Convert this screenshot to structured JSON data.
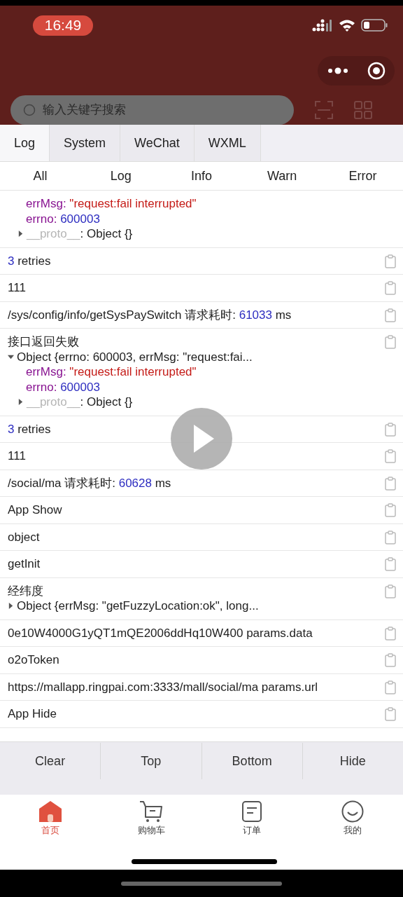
{
  "status_bar": {
    "time": "16:49"
  },
  "search": {
    "placeholder": "输入关键字搜索"
  },
  "console_tabs": [
    {
      "label": "Log",
      "selected": true
    },
    {
      "label": "System",
      "selected": false
    },
    {
      "label": "WeChat",
      "selected": false
    },
    {
      "label": "WXML",
      "selected": false
    }
  ],
  "filters": [
    "All",
    "Log",
    "Info",
    "Warn",
    "Error"
  ],
  "log_entries": [
    {
      "copy": false,
      "lines": [
        {
          "kind": "string_prop",
          "key": "errMsg:",
          "value": "\"request:fail interrupted\""
        },
        {
          "kind": "number_prop",
          "key": "errno:",
          "value": "600003"
        },
        {
          "kind": "proto",
          "key": "__proto__",
          "value": ": Object {}",
          "expanded": false
        }
      ]
    },
    {
      "copy": true,
      "lines": [
        {
          "kind": "plain",
          "segments": [
            {
              "text": "3",
              "kind": "number"
            },
            {
              "text": " retries",
              "kind": "plain"
            }
          ]
        }
      ]
    },
    {
      "copy": true,
      "lines": [
        {
          "kind": "plain",
          "segments": [
            {
              "text": "111",
              "kind": "plain"
            }
          ]
        }
      ]
    },
    {
      "copy": true,
      "lines": [
        {
          "kind": "plain",
          "segments": [
            {
              "text": "/sys/config/info/getSysPaySwitch 请求耗时: ",
              "kind": "plain"
            },
            {
              "text": "61033",
              "kind": "number"
            },
            {
              "text": " ms",
              "kind": "plain"
            }
          ]
        }
      ]
    },
    {
      "copy": true,
      "lines": [
        {
          "kind": "plain",
          "segments": [
            {
              "text": "接口返回失败",
              "kind": "plain"
            }
          ]
        },
        {
          "kind": "object",
          "expanded": true,
          "text": "Object {errno: 600003, errMsg: \"request:fai..."
        },
        {
          "kind": "string_prop",
          "key": "errMsg:",
          "value": "\"request:fail interrupted\""
        },
        {
          "kind": "number_prop",
          "key": "errno:",
          "value": "600003"
        },
        {
          "kind": "proto",
          "key": "__proto__",
          "value": ": Object {}",
          "expanded": false
        }
      ]
    },
    {
      "copy": true,
      "lines": [
        {
          "kind": "plain",
          "segments": [
            {
              "text": "3",
              "kind": "number"
            },
            {
              "text": " retries",
              "kind": "plain"
            }
          ]
        }
      ]
    },
    {
      "copy": true,
      "lines": [
        {
          "kind": "plain",
          "segments": [
            {
              "text": "111",
              "kind": "plain"
            }
          ]
        }
      ]
    },
    {
      "copy": true,
      "lines": [
        {
          "kind": "plain",
          "segments": [
            {
              "text": "/social/ma 请求耗时: ",
              "kind": "plain"
            },
            {
              "text": "60628",
              "kind": "number"
            },
            {
              "text": " ms",
              "kind": "plain"
            }
          ]
        }
      ]
    },
    {
      "copy": true,
      "lines": [
        {
          "kind": "plain",
          "segments": [
            {
              "text": "App Show",
              "kind": "plain"
            }
          ]
        }
      ]
    },
    {
      "copy": true,
      "lines": [
        {
          "kind": "plain",
          "segments": [
            {
              "text": "object",
              "kind": "plain"
            }
          ]
        }
      ]
    },
    {
      "copy": true,
      "lines": [
        {
          "kind": "plain",
          "segments": [
            {
              "text": "getInit",
              "kind": "plain"
            }
          ]
        }
      ]
    },
    {
      "copy": true,
      "lines": [
        {
          "kind": "plain",
          "segments": [
            {
              "text": "经纬度",
              "kind": "plain"
            }
          ]
        },
        {
          "kind": "object",
          "expanded": false,
          "text": "Object {errMsg: \"getFuzzyLocation:ok\", long..."
        }
      ]
    },
    {
      "copy": true,
      "lines": [
        {
          "kind": "plain",
          "segments": [
            {
              "text": "0e10W4000G1yQT1mQE2006ddHq10W400 params.data",
              "kind": "plain"
            }
          ]
        }
      ]
    },
    {
      "copy": true,
      "lines": [
        {
          "kind": "plain",
          "segments": [
            {
              "text": "o2oToken",
              "kind": "plain"
            }
          ]
        }
      ]
    },
    {
      "copy": true,
      "lines": [
        {
          "kind": "plain",
          "segments": [
            {
              "text": "https://mallapp.ringpai.com:3333/mall/social/ma params.url",
              "kind": "plain"
            }
          ]
        }
      ]
    },
    {
      "copy": true,
      "lines": [
        {
          "kind": "plain",
          "segments": [
            {
              "text": "App Hide",
              "kind": "plain"
            }
          ]
        }
      ]
    }
  ],
  "actions": [
    "Clear",
    "Top",
    "Bottom",
    "Hide"
  ],
  "bottom_nav": [
    {
      "label": "首页",
      "kind": "home",
      "selected": true
    },
    {
      "label": "购物车",
      "kind": "cart",
      "selected": false
    },
    {
      "label": "订单",
      "kind": "order",
      "selected": false
    },
    {
      "label": "我的",
      "kind": "me",
      "selected": false
    }
  ]
}
